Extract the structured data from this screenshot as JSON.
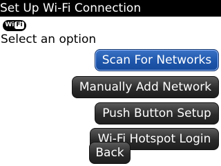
{
  "window": {
    "title": "Set Up Wi-Fi Connection"
  },
  "header": {
    "wifi_badge": {
      "icon": "wifi-icon",
      "text_left": "Wi",
      "text_right": "Fi"
    },
    "prompt": "Select an option"
  },
  "options": [
    {
      "label": "Scan For Networks",
      "focused": true
    },
    {
      "label": "Manually Add Network",
      "focused": false
    },
    {
      "label": "Push Button Setup",
      "focused": false
    },
    {
      "label": "Wi-Fi Hotspot Login",
      "focused": false
    }
  ],
  "footer": {
    "back_label": "Back"
  },
  "colors": {
    "titlebar_bg": "#000000",
    "focus_accent": "#1e56ab",
    "button_bg": "#2b2b2b"
  }
}
